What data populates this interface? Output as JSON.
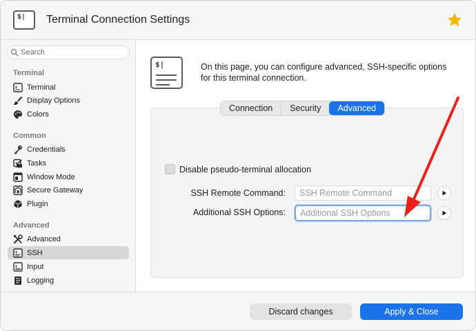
{
  "window": {
    "title": "Terminal Connection Settings",
    "favorite_icon": "star-icon",
    "accent_color": "#1a73e8"
  },
  "sidebar": {
    "search_placeholder": "Search",
    "sections": [
      {
        "label": "Terminal",
        "items": [
          {
            "label": "Terminal",
            "icon": "terminal-icon"
          },
          {
            "label": "Display Options",
            "icon": "brush-icon"
          },
          {
            "label": "Colors",
            "icon": "palette-icon"
          }
        ]
      },
      {
        "label": "Common",
        "items": [
          {
            "label": "Credentials",
            "icon": "key-icon"
          },
          {
            "label": "Tasks",
            "icon": "tasks-icon"
          },
          {
            "label": "Window Mode",
            "icon": "window-icon"
          },
          {
            "label": "Secure Gateway",
            "icon": "gateway-icon"
          },
          {
            "label": "Plugin",
            "icon": "plugin-icon"
          }
        ]
      },
      {
        "label": "Advanced",
        "items": [
          {
            "label": "Advanced",
            "icon": "tools-icon"
          },
          {
            "label": "SSH",
            "icon": "ssh-icon",
            "selected": true
          },
          {
            "label": "Input",
            "icon": "input-icon"
          },
          {
            "label": "Logging",
            "icon": "logging-icon"
          }
        ]
      }
    ]
  },
  "main": {
    "description": "On this page, you can configure advanced, SSH-specific options for this terminal connection.",
    "tabs": [
      {
        "label": "Connection",
        "active": false
      },
      {
        "label": "Security",
        "active": false
      },
      {
        "label": "Advanced",
        "active": true
      }
    ],
    "checkbox": {
      "label": "Disable pseudo-terminal allocation",
      "checked": false
    },
    "fields": [
      {
        "label": "SSH Remote Command:",
        "value": "",
        "placeholder": "SSH Remote Command"
      },
      {
        "label": "Additional SSH Options:",
        "value": "",
        "placeholder": "Additional SSH Options",
        "focused": true
      }
    ]
  },
  "footer": {
    "discard_label": "Discard changes",
    "apply_label": "Apply & Close"
  },
  "annotation": {
    "arrow_color": "#e8221b"
  }
}
